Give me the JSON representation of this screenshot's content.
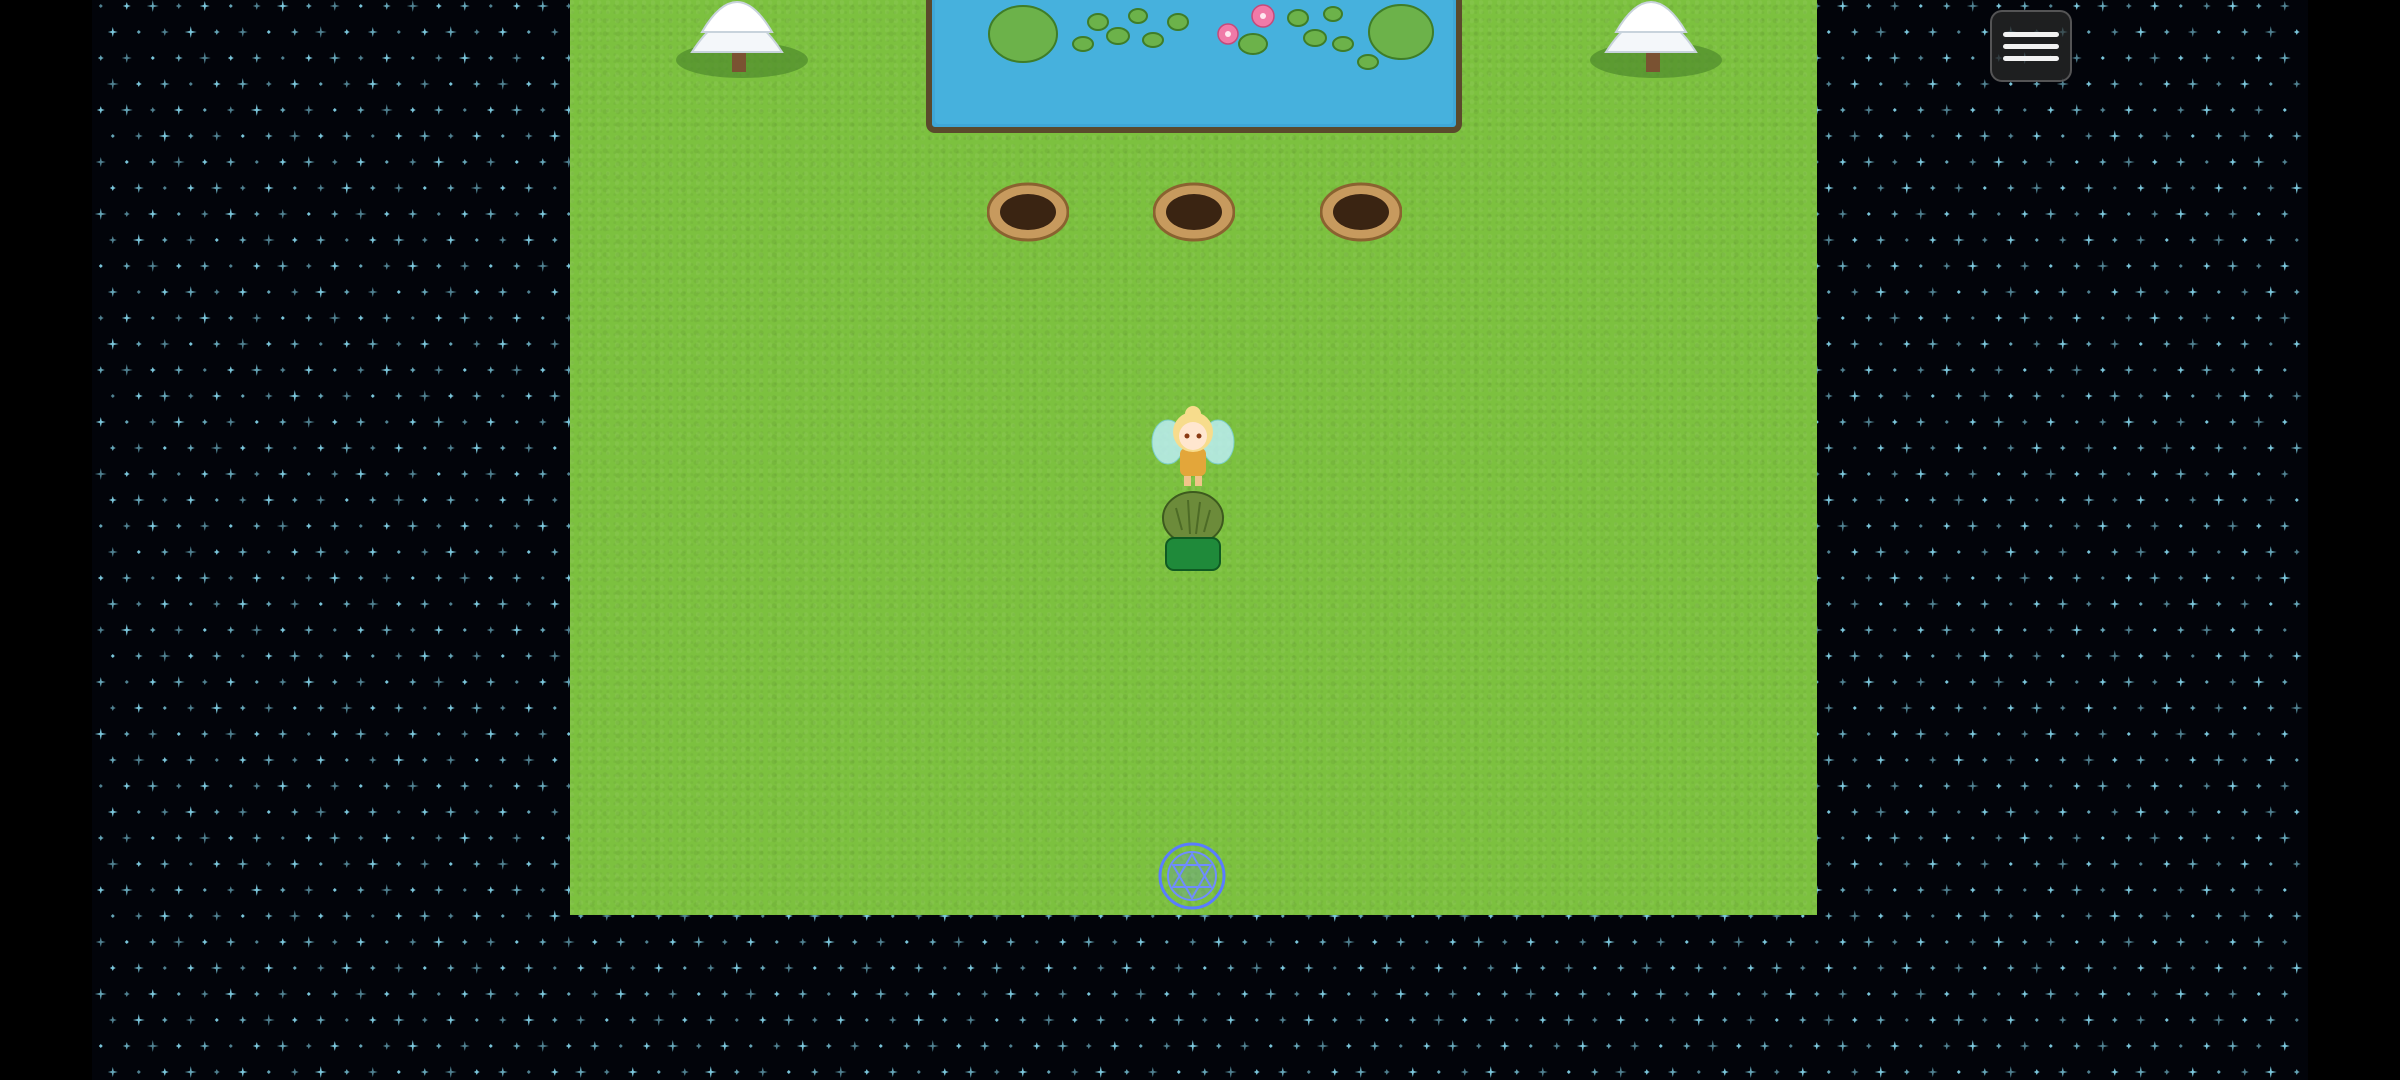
{
  "menu": {
    "icon": "hamburger-menu-icon"
  },
  "scene": {
    "background": "starfield",
    "map_tile": "grass",
    "objects": [
      {
        "name": "pond",
        "icon": "lily-pond"
      },
      {
        "name": "snow-tree-left",
        "icon": "snow-tree"
      },
      {
        "name": "snow-tree-right",
        "icon": "snow-tree"
      },
      {
        "name": "dirt-hole-1",
        "icon": "dirt-hole"
      },
      {
        "name": "dirt-hole-2",
        "icon": "dirt-hole"
      },
      {
        "name": "dirt-hole-3",
        "icon": "dirt-hole"
      },
      {
        "name": "fairy-character",
        "icon": "fairy"
      },
      {
        "name": "green-bush",
        "icon": "bush"
      },
      {
        "name": "magic-circle",
        "icon": "hexagram-circle"
      }
    ]
  },
  "colors": {
    "grass": "#7cc13f",
    "water": "#3fa7d6",
    "star": "#8fe8ff",
    "space": "#02040a"
  }
}
